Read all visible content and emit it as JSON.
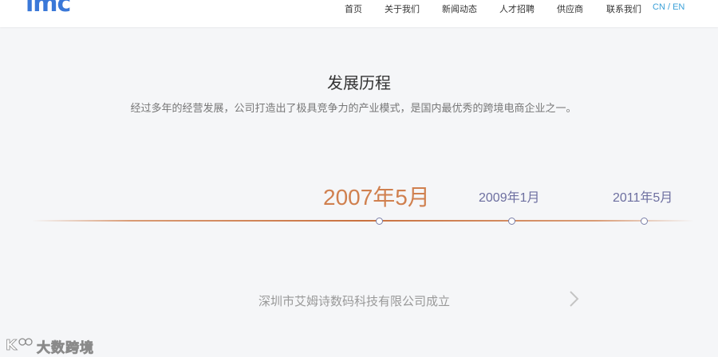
{
  "header": {
    "logo_text": "imc",
    "nav": [
      "首页",
      "关于我们",
      "新闻动态",
      "人才招聘",
      "供应商",
      "联系我们"
    ],
    "lang": {
      "cn": "CN",
      "sep": " / ",
      "en": "EN"
    }
  },
  "section": {
    "title": "发展历程",
    "subtitle": "经过多年的经营发展，公司打造出了极具竞争力的产业模式，是国内最优秀的跨境电商企业之一。"
  },
  "timeline": {
    "dates": [
      "2007年5月",
      "2009年1月",
      "2011年5月"
    ],
    "active_index": 0,
    "event": "深圳市艾姆诗数码科技有限公司成立"
  },
  "watermark": {
    "text": "大数跨境"
  },
  "colors": {
    "accent": "#d0804f",
    "inactive_date": "#6d6fa0",
    "logo": "#3a78d8",
    "lang": "#3aa0d8"
  },
  "icons": [
    "chevron-right-icon",
    "watermark-logo-icon"
  ]
}
